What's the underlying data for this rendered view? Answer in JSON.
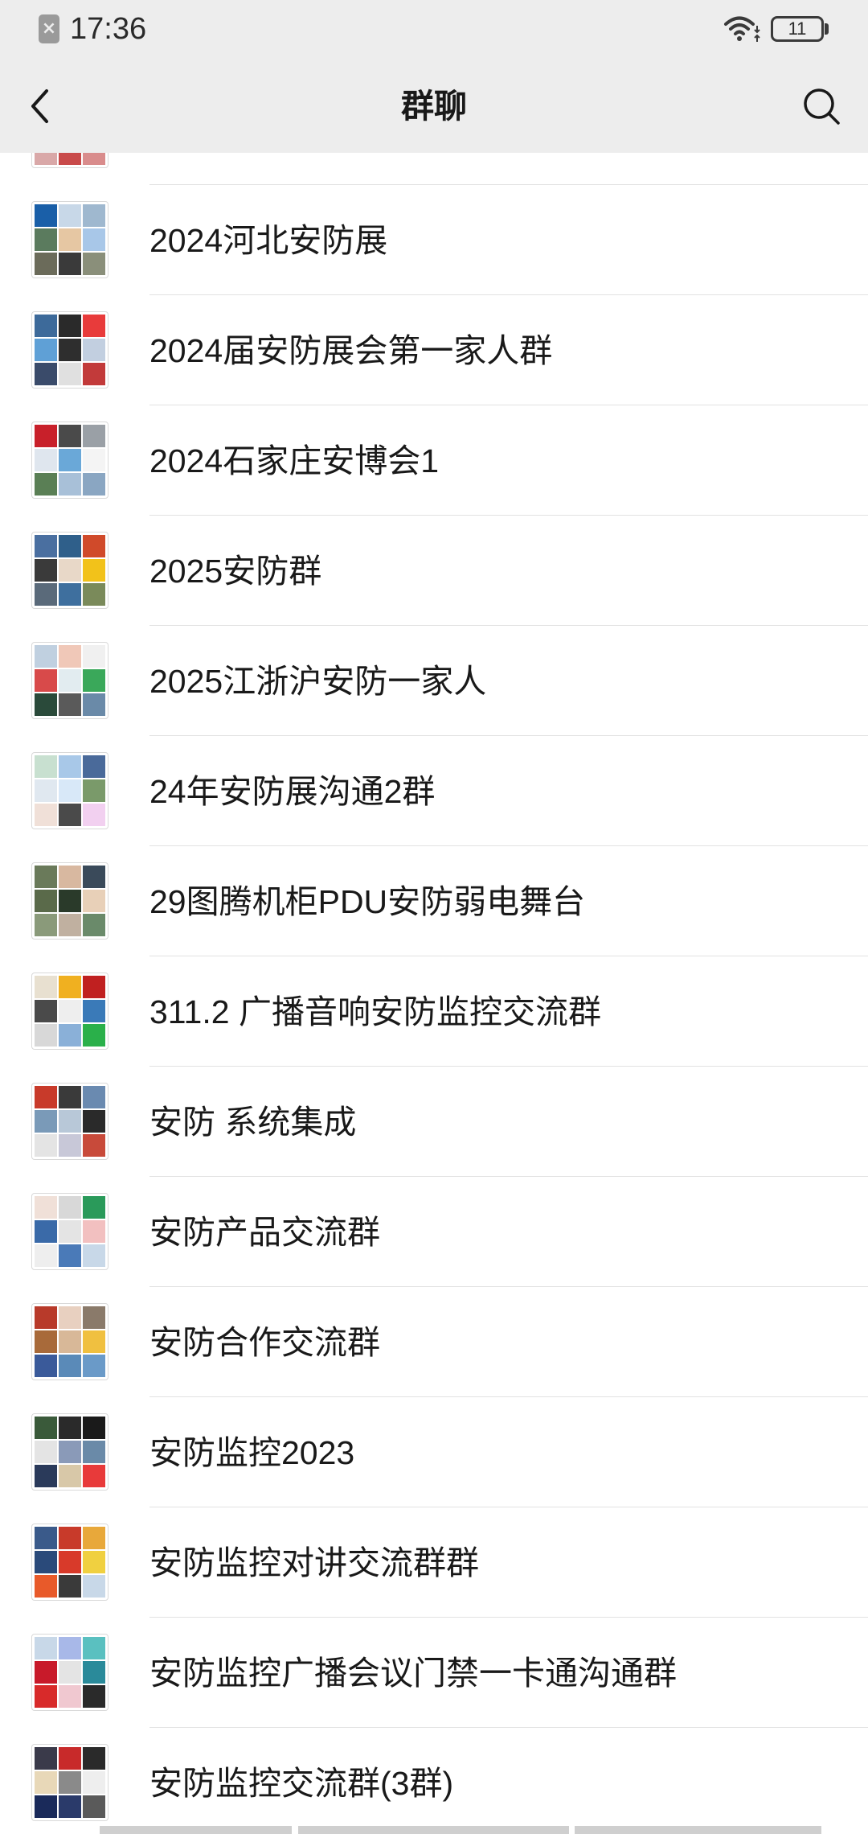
{
  "theme": {
    "header_bg": "#ededed",
    "list_bg": "#ffffff",
    "divider": "#e2e2e2",
    "text": "#191919"
  },
  "status_bar": {
    "time": "17:36",
    "battery_level": "11",
    "left_icon": "sim-blocked-icon",
    "wifi_icon": "wifi-icon",
    "battery_icon": "battery-icon"
  },
  "nav": {
    "title": "群聊",
    "back_icon": "chevron-left-icon",
    "search_icon": "search-icon"
  },
  "rows": [
    {
      "tiles": [
        "#f2e6e6",
        "#ebe1e1",
        "#e8dede",
        "#f0e2e2",
        "#ece0e0",
        "#e9dcdc",
        "#d9a8a8",
        "#c94a4a",
        "#d98c8c"
      ]
    },
    {
      "name": "2024河北安防展",
      "tiles": [
        "#1a5fa8",
        "#c8d8e8",
        "#9fb8cf",
        "#5b7b5e",
        "#e6c7a3",
        "#a8c7e8",
        "#6b6b5a",
        "#3a3a3a",
        "#8a8f7a"
      ]
    },
    {
      "name": "2024届安防展会第一家人群",
      "tiles": [
        "#3d6a9a",
        "#2a2a2a",
        "#e83b3b",
        "#5fa0d6",
        "#2e2e2e",
        "#c2cfe0",
        "#3a4b6a",
        "#e0e0e0",
        "#c23a3a"
      ]
    },
    {
      "name": "2024石家庄安博会1",
      "tiles": [
        "#c8202a",
        "#4a4a4a",
        "#9aa0a6",
        "#dfe6ee",
        "#6aa8d8",
        "#f4f4f4",
        "#5a7f55",
        "#a8c0d8",
        "#8aa6c2"
      ]
    },
    {
      "name": "2025安防群",
      "tiles": [
        "#4a6fa0",
        "#2f5f8a",
        "#d04a2a",
        "#3a3a3a",
        "#e8d8c8",
        "#f2c21a",
        "#5a6a7a",
        "#3e6f9e",
        "#7a8a5a"
      ]
    },
    {
      "name": "2025江浙沪安防一家人",
      "tiles": [
        "#c0d0e0",
        "#f0c8b8",
        "#f0f0f0",
        "#d84a4a",
        "#e2ecf0",
        "#3aa85a",
        "#2a4a3a",
        "#5a5a5a",
        "#6a8aa8"
      ]
    },
    {
      "name": "24年安防展沟通2群",
      "tiles": [
        "#c8e0d0",
        "#a8c8e8",
        "#4a6a9a",
        "#e0e8f0",
        "#d8e8f8",
        "#7a9a6a",
        "#f0e0d8",
        "#4a4a4a",
        "#f2d0f0"
      ]
    },
    {
      "name": "29图腾机柜PDU安防弱电舞台",
      "tiles": [
        "#6a7a5a",
        "#d8b8a0",
        "#3a4a5a",
        "#5a6a4a",
        "#2a3a2a",
        "#e8d0b8",
        "#8a9a7a",
        "#c0b0a0",
        "#6a8a6a"
      ]
    },
    {
      "name": "311.2 广播音响安防监控交流群",
      "tiles": [
        "#e8e0d0",
        "#f0b020",
        "#c02020",
        "#4a4a4a",
        "#eeeeee",
        "#3a7ab8",
        "#d8d8d8",
        "#8ab0d8",
        "#2ab04a"
      ]
    },
    {
      "name": "安防 系统集成",
      "tiles": [
        "#c83a2a",
        "#3a3a3a",
        "#6a8ab0",
        "#7a9ab8",
        "#b8c8d8",
        "#2a2a2a",
        "#e4e4e4",
        "#c8c8d8",
        "#c84a3a"
      ]
    },
    {
      "name": "安防产品交流群",
      "tiles": [
        "#f0e0d8",
        "#d8d8d8",
        "#2a9a5a",
        "#3a6aa8",
        "#e4e4e4",
        "#f2c0c0",
        "#eeeeee",
        "#4a7ab8",
        "#c8d8e8"
      ]
    },
    {
      "name": "安防合作交流群",
      "tiles": [
        "#b83a2a",
        "#e8d0c0",
        "#8a7a6a",
        "#a86a3a",
        "#d8b898",
        "#f0c040",
        "#3a5a9a",
        "#5a8ab8",
        "#6a9ac8"
      ]
    },
    {
      "name": "安防监控2023",
      "tiles": [
        "#3a5a3a",
        "#2a2a2a",
        "#1a1a1a",
        "#e4e4e4",
        "#8a9ab8",
        "#6a8aa8",
        "#2a3a5a",
        "#d8c8a8",
        "#e83a3a"
      ]
    },
    {
      "name": "安防监控对讲交流群群",
      "tiles": [
        "#3a5a8a",
        "#c83a2a",
        "#e8a83a",
        "#2a4a7a",
        "#d83a2a",
        "#f0d040",
        "#e85a2a",
        "#3a3a3a",
        "#c8d8e8"
      ]
    },
    {
      "name": "安防监控广播会议门禁一卡通沟通群",
      "tiles": [
        "#c8d8e8",
        "#a8b8e8",
        "#5ac0c0",
        "#c81a2a",
        "#e4e4e4",
        "#2a8a9a",
        "#d82a2a",
        "#f0c8d0",
        "#2a2a2a"
      ]
    },
    {
      "name": "安防监控交流群(3群)",
      "tiles": [
        "#3a3a4a",
        "#c82a2a",
        "#2a2a2a",
        "#e8d8b8",
        "#8a8a8a",
        "#eeeeee",
        "#1a2a5a",
        "#2a3a6a",
        "#5a5a5a"
      ]
    }
  ]
}
